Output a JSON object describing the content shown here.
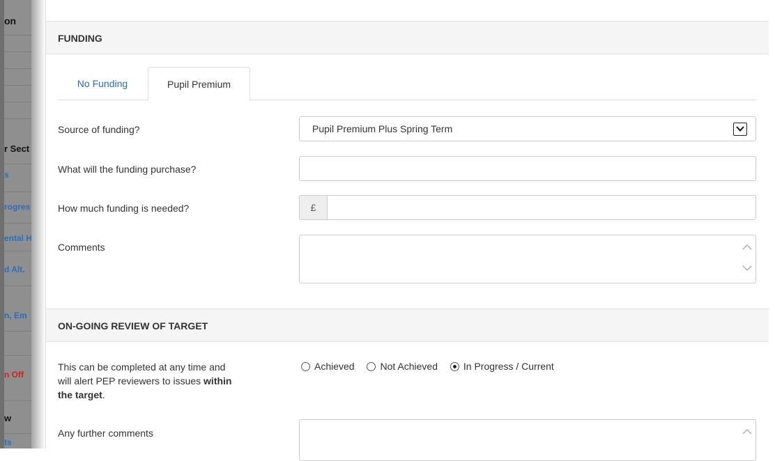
{
  "sidebar": {
    "items": [
      {
        "text": "on",
        "color": "#111111"
      },
      {
        "text": "r Sect",
        "color": "#111111"
      },
      {
        "text": "s",
        "color": "#2a6ebb"
      },
      {
        "text": "rogres",
        "color": "#2a6ebb"
      },
      {
        "text": "ental H",
        "color": "#2a6ebb"
      },
      {
        "text": "d Alt.",
        "color": "#2a6ebb"
      },
      {
        "text": "n, Em",
        "color": "#2a6ebb"
      },
      {
        "text": "n Off",
        "color": "#cc2222"
      },
      {
        "text": "w",
        "color": "#111111"
      },
      {
        "text": "ts",
        "color": "#2a6ebb"
      }
    ]
  },
  "funding": {
    "header": "FUNDING",
    "tabs": [
      {
        "label": "No Funding",
        "active": false
      },
      {
        "label": "Pupil Premium",
        "active": true
      }
    ],
    "source_label": "Source of funding?",
    "source_value": "Pupil Premium Plus Spring Term",
    "purchase_label": "What will the funding purchase?",
    "purchase_value": "",
    "amount_label": "How much funding is needed?",
    "currency_symbol": "£",
    "amount_value": "",
    "comments_label": "Comments",
    "comments_value": ""
  },
  "review": {
    "header": "ON-GOING REVIEW OF TARGET",
    "help_text_1": "This can be completed at any time and",
    "help_text_2": "will alert PEP reviewers to issues ",
    "help_text_bold_1": "within",
    "help_text_bold_2": "the target",
    "help_text_end": ".",
    "options": [
      {
        "label": "Achieved",
        "checked": false
      },
      {
        "label": "Not Achieved",
        "checked": false
      },
      {
        "label": "In Progress / Current",
        "checked": true
      }
    ],
    "further_comments_label": "Any further comments",
    "further_comments_value": ""
  },
  "colors": {
    "link": "#2a6ebb",
    "header_bg": "#f5f5f5",
    "border": "#cccccc"
  }
}
